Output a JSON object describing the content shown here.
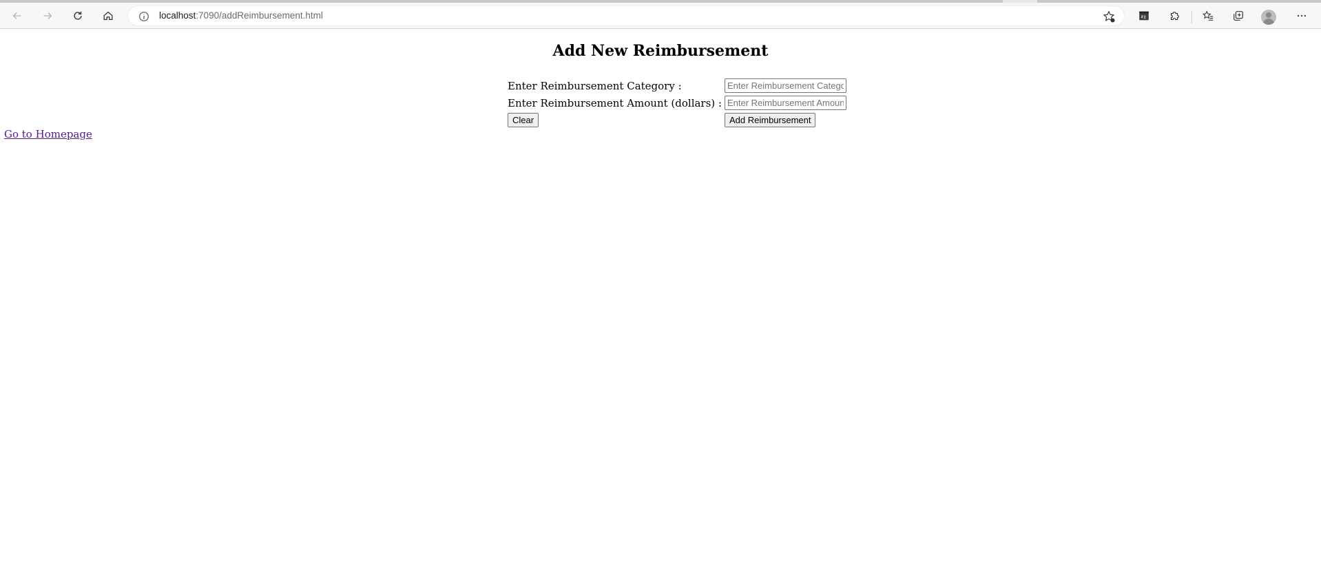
{
  "browser": {
    "url_host": "localhost",
    "url_path": ":7090/addReimbursement.html"
  },
  "page": {
    "title": "Add New Reimbursement",
    "form": {
      "category_label": "Enter Reimbursement Category :",
      "category_placeholder": "Enter Reimbursement Category",
      "amount_label": "Enter Reimbursement Amount (dollars) :",
      "amount_placeholder": "Enter Reimbursement Amount",
      "clear_label": "Clear",
      "submit_label": "Add Reimbursement"
    },
    "home_link": "Go to Homepage"
  }
}
